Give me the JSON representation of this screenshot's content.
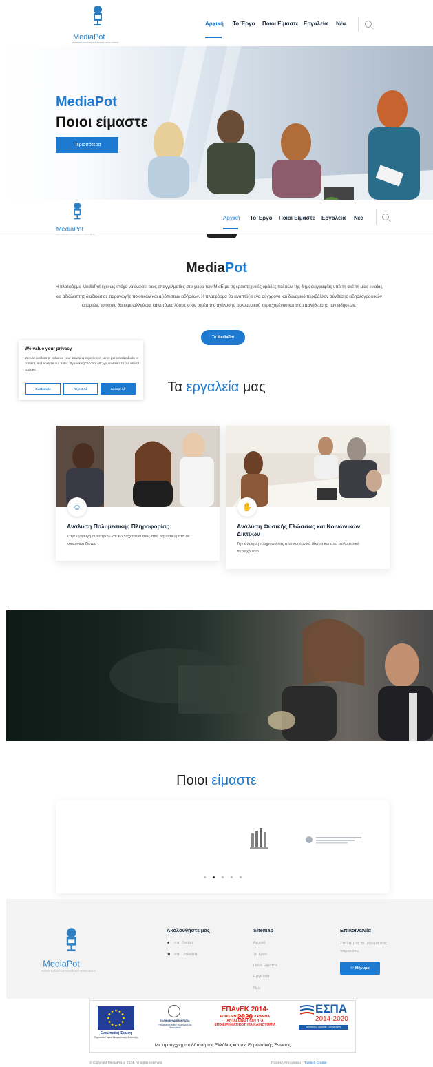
{
  "brand": {
    "name": "MediaPot",
    "tagline": "ΠΛΑΤΦΟΡΜΑ ΑΝΑΛΥΣΗΣ ΠΟΛΥΜΕΣΙΚΟΥ ΠΕΡΙΕΧΟΜΕΝΟΥ"
  },
  "nav": {
    "items": [
      "Αρχική",
      "Το Έργο",
      "Ποιοι Είμαστε",
      "Εργαλεία",
      "Νέα"
    ],
    "active": "Αρχική"
  },
  "hero": {
    "title": "MediaPot",
    "subtitle": "Ποιοι είμαστε",
    "button": "Περισσότερα"
  },
  "about": {
    "title_part1": "Media",
    "title_part2": "Pot",
    "text": "Η πλατφόρμα MediaPot έχει ως στόχο να ενώσει τους επαγγελματίες στο χώρο των ΜΜΕ με τις ερασιτεχνικές ομάδες πολιτών της δημοσιογραφίας υπό τη σκέπη μίας ενιαίας και αδιάλειπτης διαδικασίας παραγωγής ποιοτικών και αξιόπιστων ειδήσεων. Η πλατφόρμα θα αναπτύξει ένα σύγχρονο και δυναμικό περιβάλλον σύνθεσης ειδησεογραφικών ιστοριών, το οποίο θα εκμεταλλεύεται καινοτόμες λύσεις στον τομέα της ανάλυσης πολυμεσικού περιεχομένου και της επαλήθευσης των ειδήσεων.",
    "button": "Το MediaPot"
  },
  "cookie": {
    "title": "We value your privacy",
    "text": "We use cookies to enhance your browsing experience, serve personalized ads or content, and analyze our traffic. By clicking \"Accept All\", you consent to our use of cookies.",
    "customize": "Customize",
    "reject": "Reject All",
    "accept": "Accept All"
  },
  "tools": {
    "title_part1": "Τα ",
    "title_part2": "εργαλεία",
    "title_part3": " μας",
    "cards": [
      {
        "title": "Ανάλυση Πολυμεσικής Πληροφορίας",
        "desc": "Στην εξαγωγή οντοτήτων και των σχέσεων τους από δημοσιεύματα σε κοινωνικά δίκτυα",
        "icon": "people-icon"
      },
      {
        "title": "Ανάλυση Φυσικής Γλώσσας και Κοινωνικών Δικτύων",
        "desc": "Την άντληση πληροφορίας από κοινωνικά δίκτυα και από πολυμεσικό περιεχόμενο",
        "icon": "hands-icon"
      }
    ]
  },
  "partners": {
    "title_part1": "Ποιοι ",
    "title_part2": "είμαστε",
    "slides": 5,
    "active_slide": 2
  },
  "footer": {
    "follow": {
      "heading": "Ακολουθήστε μας",
      "twitter": "στο Twitter",
      "linkedin": "στο LinkedIN"
    },
    "sitemap": {
      "heading": "Sitemap",
      "links": [
        "Αρχική",
        "Το έργο",
        "Ποιοι Είμαστε",
        "Εργαλεία",
        "Νέα"
      ]
    },
    "contact": {
      "heading": "Επικοινωνία",
      "text": "Στείλτε μας το μήνυμα σας παρακάτω.",
      "button": "Μήνυμα"
    }
  },
  "funding": {
    "eu": "Ευρωπαϊκή Ένωση",
    "eu_sub": "Ευρωπαϊκό Ταμείο Περιφερειακής Ανάπτυξης",
    "hellenic": "ΕΛΛΗΝΙΚΗ ΔΗΜΟΚΡΑΤΙΑ",
    "hellenic_sub": "Υπουργείο Εθνικής Οικονομίας και Οικονομικών",
    "epanek": "ΕΠΑνΕΚ 2014-2020",
    "epanek_sub": "ΕΠΙΧΕΙΡΗΣΙΑΚΟ ΠΡΟΓΡΑΜΜΑ ΑΝΤΑΓΩΝΙΣΤΙΚΟΤΗΤΑ ΕΠΙΧΕΙΡΗΜΑΤΙΚΟΤΗΤΑ ΚΑΙΝΟΤΟΜΙΑ",
    "espa": "ΕΣΠΑ",
    "espa_years": "2014-2020",
    "espa_sub": "ανάπτυξη - εργασία - αλληλεγγύη",
    "caption": "Με τη συγχρηματοδότηση της Ελλάδας και της Ευρωπαϊκής Ένωσης"
  },
  "copyright": {
    "left": "© Copyright MediaPot.gr 2024. All rights reserved.",
    "privacy": "Πολιτική Απορρήτου",
    "sep": " | ",
    "cookies": "Πολιτική Cookie"
  },
  "colors": {
    "accent": "#1d7ad0",
    "dark": "#1b2a3a"
  }
}
